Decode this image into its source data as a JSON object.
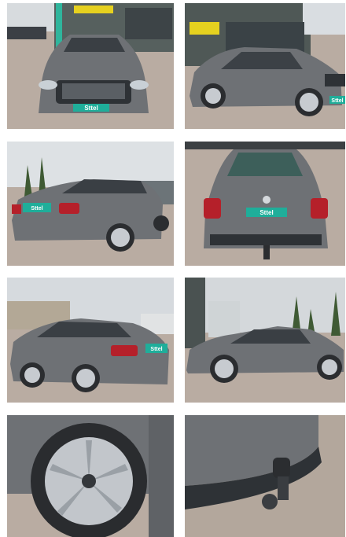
{
  "gallery": {
    "photos": [
      {
        "view": "front",
        "plate_text": "Sttel"
      },
      {
        "view": "front-right-three-quarter",
        "plate_text": "Sttel"
      },
      {
        "view": "rear-left-three-quarter",
        "plate_text": "Sttel"
      },
      {
        "view": "rear",
        "plate_text": "Sttel"
      },
      {
        "view": "rear-left-side",
        "plate_text": "Sttel"
      },
      {
        "view": "left-side",
        "plate_text": ""
      },
      {
        "view": "wheel-detail",
        "plate_text": ""
      },
      {
        "view": "tow-hitch-detail",
        "plate_text": ""
      }
    ]
  },
  "colors": {
    "car_body": "#6e7175",
    "pavement": "#b9aca2",
    "sky": "#d9dde1",
    "plate_teal": "#1fae9a",
    "tail_light": "#b5202a"
  }
}
